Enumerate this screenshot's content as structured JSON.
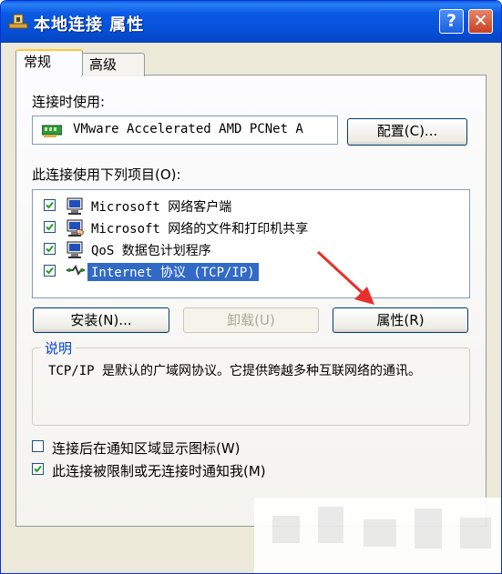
{
  "window": {
    "title": "本地连接 属性",
    "help_label": "?",
    "close_label": "✕"
  },
  "tabs": [
    {
      "label": "常规",
      "active": true
    },
    {
      "label": "高级",
      "active": false
    }
  ],
  "connect_using": {
    "label": "连接时使用:",
    "adapter_name": "VMware Accelerated AMD PCNet A",
    "configure_button": "配置(C)..."
  },
  "components": {
    "label": "此连接使用下列项目(O):",
    "items": [
      {
        "label": "Microsoft 网络客户端",
        "checked": true,
        "icon": "network-client-icon"
      },
      {
        "label": "Microsoft 网络的文件和打印机共享",
        "checked": true,
        "icon": "file-printer-sharing-icon"
      },
      {
        "label": "QoS 数据包计划程序",
        "checked": true,
        "icon": "qos-scheduler-icon"
      },
      {
        "label": "Internet 协议 (TCP/IP)",
        "checked": true,
        "selected": true,
        "icon": "protocol-icon"
      }
    ]
  },
  "buttons": {
    "install": "安装(N)...",
    "uninstall": "卸载(U)",
    "properties": "属性(R)"
  },
  "description": {
    "label": "说明",
    "text": "TCP/IP 是默认的广域网协议。它提供跨越多种互联网络的通讯。"
  },
  "options": [
    {
      "label": "连接后在通知区域显示图标(W)",
      "checked": false
    },
    {
      "label": "此连接被限制或无连接时通知我(M)",
      "checked": true
    }
  ],
  "colors": {
    "title_bar": "#0a5ae4",
    "selection": "#316ac5",
    "annotation_arrow": "#e8302a"
  }
}
